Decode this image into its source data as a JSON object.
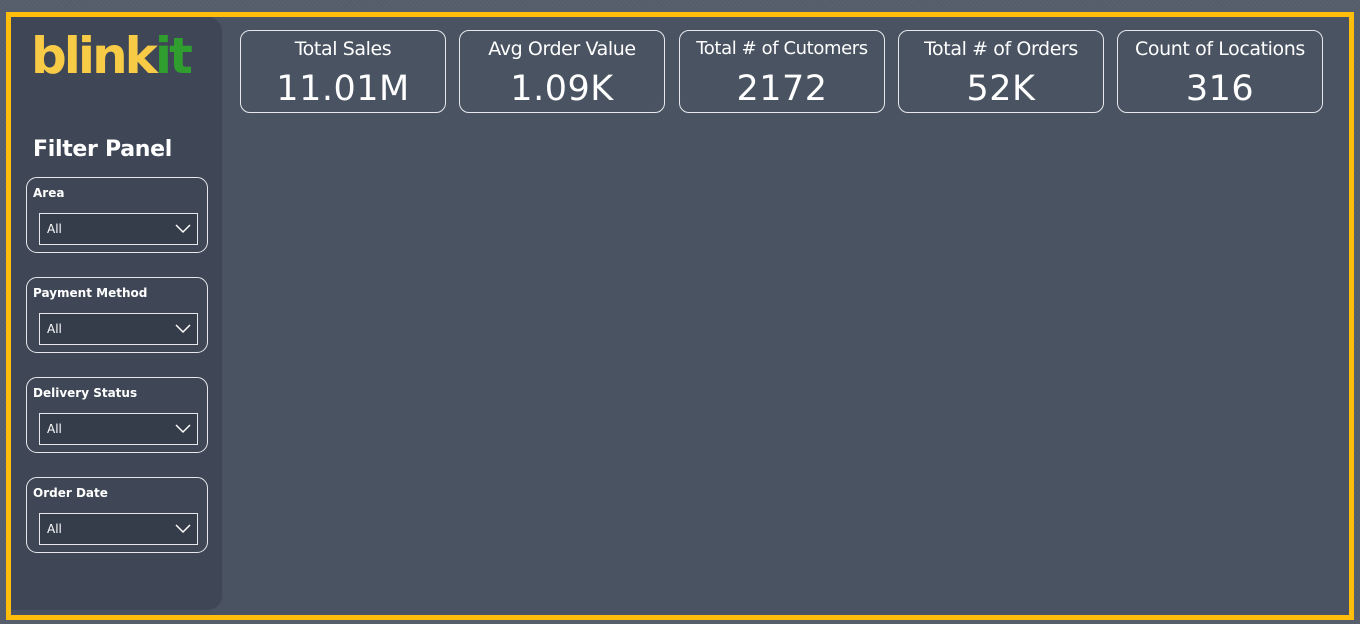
{
  "logo": {
    "part1": "blink",
    "part2": "it"
  },
  "filter_panel": {
    "title": "Filter Panel",
    "slicers": [
      {
        "label": "Area",
        "value": "All"
      },
      {
        "label": "Payment Method",
        "value": "All"
      },
      {
        "label": "Delivery Status",
        "value": "All"
      },
      {
        "label": "Order Date",
        "value": "All"
      }
    ]
  },
  "kpis": [
    {
      "label": "Total Sales",
      "value": "11.01M"
    },
    {
      "label": "Avg Order Value",
      "value": "1.09K"
    },
    {
      "label": "Total # of Cutomers",
      "value": "2172"
    },
    {
      "label": "Total # of Orders",
      "value": "52K"
    },
    {
      "label": "Count of Locations",
      "value": "316"
    }
  ],
  "colors": {
    "frame_border": "#ffbe0b",
    "canvas": "#4a5362",
    "sidebar": "#3f4756",
    "logo_yellow": "#f8cb46",
    "logo_green": "#2f9e2f"
  },
  "icons": {
    "dropdown": "chevron-down-icon"
  }
}
